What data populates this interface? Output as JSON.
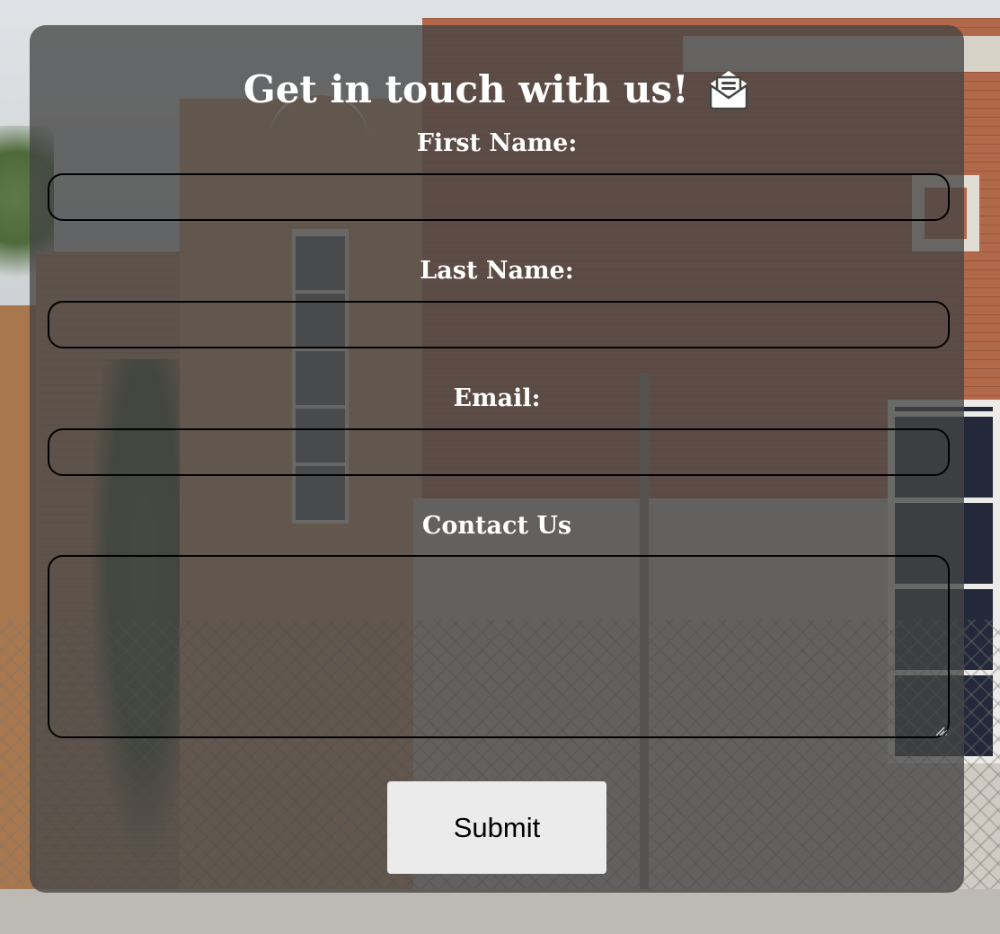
{
  "form": {
    "title": "Get in touch with us!",
    "title_icon": "envelope-open-text-icon",
    "fields": {
      "first_name": {
        "label": "First Name:",
        "value": "",
        "placeholder": ""
      },
      "last_name": {
        "label": "Last Name:",
        "value": "",
        "placeholder": ""
      },
      "email": {
        "label": "Email:",
        "value": "",
        "placeholder": ""
      },
      "message": {
        "label": "Contact Us",
        "value": "",
        "placeholder": ""
      }
    },
    "submit_label": "Submit"
  },
  "colors": {
    "panel_overlay": "#444444",
    "text": "#ffffff",
    "field_border": "#000000",
    "button_bg": "#ebebeb",
    "button_text": "#000000"
  },
  "background": {
    "type": "photo",
    "subject": "brick-and-concrete-building-behind-chain-link-fence"
  }
}
